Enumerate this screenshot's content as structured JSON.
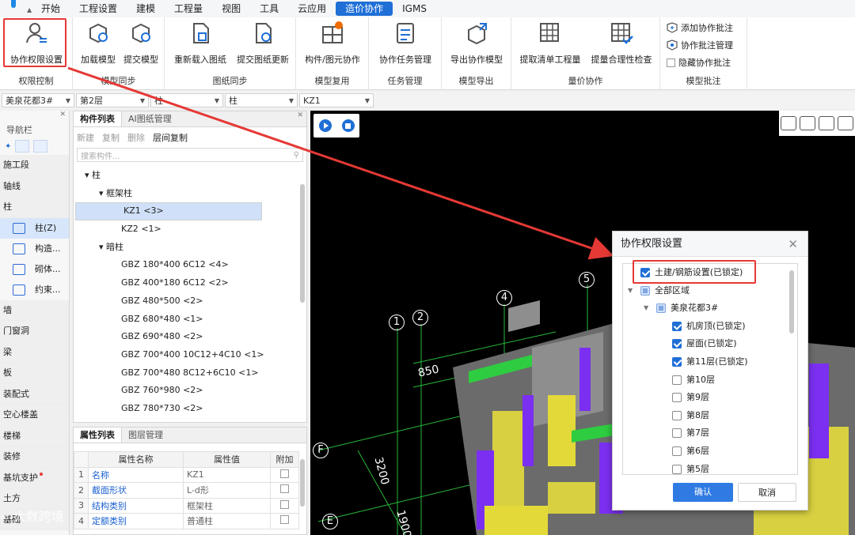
{
  "menu": [
    "开始",
    "工程设置",
    "建模",
    "工程量",
    "视图",
    "工具",
    "云应用",
    "造价协作",
    "IGMS"
  ],
  "ribbon": {
    "groups": [
      {
        "label": "权限控制",
        "buttons": [
          "协作权限设置"
        ]
      },
      {
        "label": "模型同步",
        "buttons": [
          "加载模型",
          "提交模型"
        ]
      },
      {
        "label": "图纸同步",
        "buttons": [
          "重新载入图纸",
          "提交图纸更新"
        ]
      },
      {
        "label": "模型复用",
        "buttons": [
          "构件/图元协作"
        ]
      },
      {
        "label": "任务管理",
        "buttons": [
          "协作任务管理"
        ]
      },
      {
        "label": "模型导出",
        "buttons": [
          "导出协作模型"
        ]
      },
      {
        "label": "量价协作",
        "buttons": [
          "提取清单工程量",
          "提量合理性检查"
        ]
      },
      {
        "label": "模型批注",
        "buttons": [
          "添加协作批注",
          "协作批注管理",
          "隐藏协作批注"
        ]
      }
    ]
  },
  "selectors": [
    "美泉花都3#",
    "第2层",
    "柱",
    "柱",
    "KZ1"
  ],
  "nav": {
    "title": "导航栏",
    "items": [
      "施工段",
      "轴线",
      "柱",
      "墙",
      "门窗洞",
      "梁",
      "板",
      "装配式",
      "空心楼盖",
      "楼梯",
      "装修",
      "基坑支护",
      "土方",
      "基础"
    ],
    "sub_items": [
      "柱(Z)",
      "构造...",
      "砌体...",
      "约束..."
    ]
  },
  "components": {
    "tabs": [
      "构件列表",
      "AI图纸管理"
    ],
    "tools": [
      "新建",
      "复制",
      "删除",
      "层间复制"
    ],
    "search_placeholder": "搜索构件...",
    "tree": [
      {
        "label": "柱"
      },
      {
        "label": "框架柱"
      },
      {
        "label": "KZ1 <3>"
      },
      {
        "label": "KZ2 <1>"
      },
      {
        "label": "暗柱"
      },
      {
        "label": "GBZ 180*400 6C12 <4>"
      },
      {
        "label": "GBZ 400*180 6C12 <2>"
      },
      {
        "label": "GBZ 480*500 <2>"
      },
      {
        "label": "GBZ 680*480 <1>"
      },
      {
        "label": "GBZ 690*480 <2>"
      },
      {
        "label": "GBZ 700*400  10C12+4C10 <1>"
      },
      {
        "label": "GBZ 700*480 8C12+6C10 <1>"
      },
      {
        "label": "GBZ 760*980 <2>"
      },
      {
        "label": "GBZ 780*730 <2>"
      }
    ]
  },
  "properties": {
    "tabs": [
      "属性列表",
      "图层管理"
    ],
    "headers": [
      "属性名称",
      "属性值",
      "附加"
    ],
    "rows": [
      {
        "num": "1",
        "name": "名称",
        "value": "KZ1"
      },
      {
        "num": "2",
        "name": "截面形状",
        "value": "L-d形"
      },
      {
        "num": "3",
        "name": "结构类别",
        "value": "框架柱"
      },
      {
        "num": "4",
        "name": "定额类别",
        "value": "普通柱"
      }
    ]
  },
  "viewport": {
    "axis_labels": [
      "1",
      "2",
      "4",
      "5",
      "F",
      "E"
    ],
    "dimensions": [
      "850",
      "3200",
      "1900"
    ]
  },
  "dialog": {
    "title": "协作权限设置",
    "items": [
      {
        "label": "土建/钢筋设置(已锁定)",
        "checked": true
      },
      {
        "label": "全部区域",
        "checked": "partial"
      },
      {
        "label": "美泉花都3#",
        "checked": "partial"
      },
      {
        "label": "机房顶(已锁定)",
        "checked": true
      },
      {
        "label": "屋面(已锁定)",
        "checked": true
      },
      {
        "label": "第11层(已锁定)",
        "checked": true
      },
      {
        "label": "第10层",
        "checked": false
      },
      {
        "label": "第9层",
        "checked": false
      },
      {
        "label": "第8层",
        "checked": false
      },
      {
        "label": "第7层",
        "checked": false
      },
      {
        "label": "第6层",
        "checked": false
      },
      {
        "label": "第5层",
        "checked": false
      }
    ],
    "ok_label": "确认",
    "cancel_label": "取消"
  },
  "watermark": "大数跨境",
  "colors": {
    "accent": "#1f6fd6",
    "annotation": "#e53935"
  }
}
